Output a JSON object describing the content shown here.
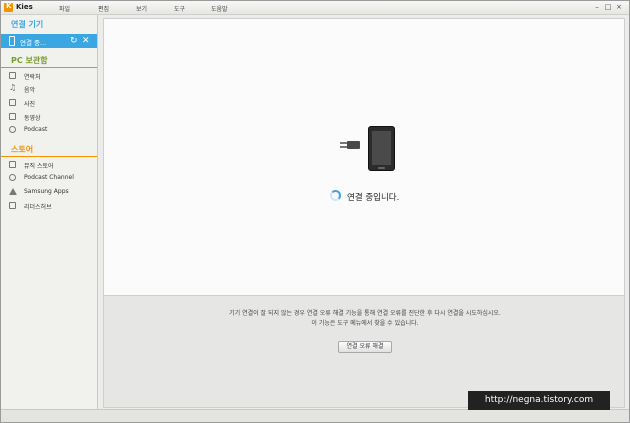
{
  "app": {
    "name": "Kies"
  },
  "menu": [
    "파일",
    "편집",
    "보기",
    "도구",
    "도움말"
  ],
  "window_controls": {
    "minimize": "–",
    "maximize": "□",
    "close": "×"
  },
  "sidebar": {
    "connected_header": "연결 기기",
    "device_label": "연결 중...",
    "pc_header": "PC 보관함",
    "pc_items": [
      "연락처",
      "음악",
      "사진",
      "동영상",
      "Podcast"
    ],
    "store_header": "스토어",
    "store_items": [
      "뮤직 스토어",
      "Podcast Channel",
      "Samsung Apps",
      "리더스허브"
    ]
  },
  "main": {
    "status": "연결 중입니다.",
    "help_line1": "기기 연결이 잘 되지 않는 경우 연결 오류 해결 기능을 통해 연결 오류를 진단한 후 다시 연결을 시도하십시오.",
    "help_line2": "이 기능은 도구 메뉴에서 찾을 수 있습니다.",
    "help_button": "연결 오류 해결"
  },
  "watermark": "http://negna.tistory.com",
  "colors": {
    "accent": "#3ba7e2",
    "pc_header": "#7a9b2e",
    "store_header": "#f29400",
    "logo": "#f29400"
  }
}
